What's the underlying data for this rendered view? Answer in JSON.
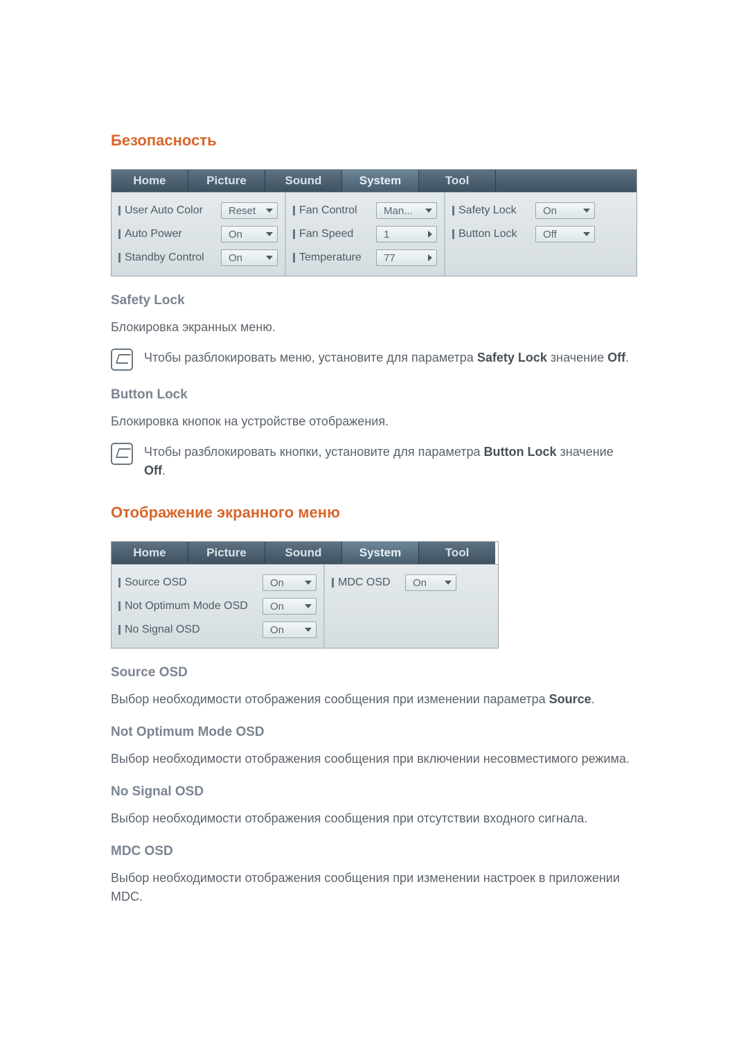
{
  "security": {
    "heading": "Безопасность",
    "tabs": [
      "Home",
      "Picture",
      "Sound",
      "System",
      "Tool"
    ],
    "activeTab": 3,
    "cols": [
      {
        "rows": [
          {
            "label": "User Auto Color",
            "value": "Reset",
            "arrow": "down",
            "labelW": 148,
            "selW": 82
          },
          {
            "label": "Auto Power",
            "value": "On",
            "arrow": "down",
            "labelW": 148,
            "selW": 82
          },
          {
            "label": "Standby Control",
            "value": "On",
            "arrow": "down",
            "labelW": 148,
            "selW": 82
          }
        ]
      },
      {
        "rows": [
          {
            "label": "Fan Control",
            "value": "Man...",
            "arrow": "down",
            "labelW": 120,
            "selW": 88
          },
          {
            "label": "Fan Speed",
            "value": "1",
            "arrow": "right",
            "labelW": 120,
            "selW": 88
          },
          {
            "label": "Temperature",
            "value": "77",
            "arrow": "right",
            "labelW": 120,
            "selW": 88
          }
        ]
      },
      {
        "rows": [
          {
            "label": "Safety Lock",
            "value": "On",
            "arrow": "down",
            "labelW": 120,
            "selW": 86
          },
          {
            "label": "Button Lock",
            "value": "Off",
            "arrow": "down",
            "labelW": 120,
            "selW": 86
          }
        ]
      }
    ]
  },
  "sl_h": "Safety Lock",
  "sl_p": "Блокировка экранных меню.",
  "sl_note_a": "Чтобы разблокировать меню, установите для параметра ",
  "sl_note_b": "Safety Lock",
  "sl_note_c": " значение ",
  "sl_note_d": "Off",
  "sl_note_e": ".",
  "bl_h": "Button Lock",
  "bl_p": "Блокировка кнопок на устройстве отображения.",
  "bl_note_a": "Чтобы разблокировать кнопки, установите для параметра ",
  "bl_note_b": "Button Lock",
  "bl_note_c": " значение ",
  "bl_note_d": "Off",
  "bl_note_e": ".",
  "osd": {
    "heading": "Отображение экранного меню",
    "tabs": [
      "Home",
      "Picture",
      "Sound",
      "System",
      "Tool"
    ],
    "activeTab": 3,
    "cols": [
      {
        "rows": [
          {
            "label": "Source OSD",
            "value": "On",
            "arrow": "down",
            "labelW": 208,
            "selW": 78
          },
          {
            "label": "Not Optimum Mode OSD",
            "value": "On",
            "arrow": "down",
            "labelW": 208,
            "selW": 78
          },
          {
            "label": "No Signal OSD",
            "value": "On",
            "arrow": "down",
            "labelW": 208,
            "selW": 78
          }
        ]
      },
      {
        "rows": [
          {
            "label": "MDC OSD",
            "value": "On",
            "arrow": "down",
            "labelW": 106,
            "selW": 74
          }
        ]
      }
    ]
  },
  "src_h": "Source OSD",
  "src_p_a": "Выбор необходимости отображения сообщения при изменении параметра ",
  "src_p_b": "Source",
  "src_p_c": ".",
  "nom_h": "Not Optimum Mode OSD",
  "nom_p": "Выбор необходимости отображения сообщения при включении несовместимого режима.",
  "nos_h": "No Signal OSD",
  "nos_p": "Выбор необходимости отображения сообщения при отсутствии входного сигнала.",
  "mdc_h": "MDC OSD",
  "mdc_p": "Выбор необходимости отображения сообщения при изменении настроек в приложении MDC."
}
